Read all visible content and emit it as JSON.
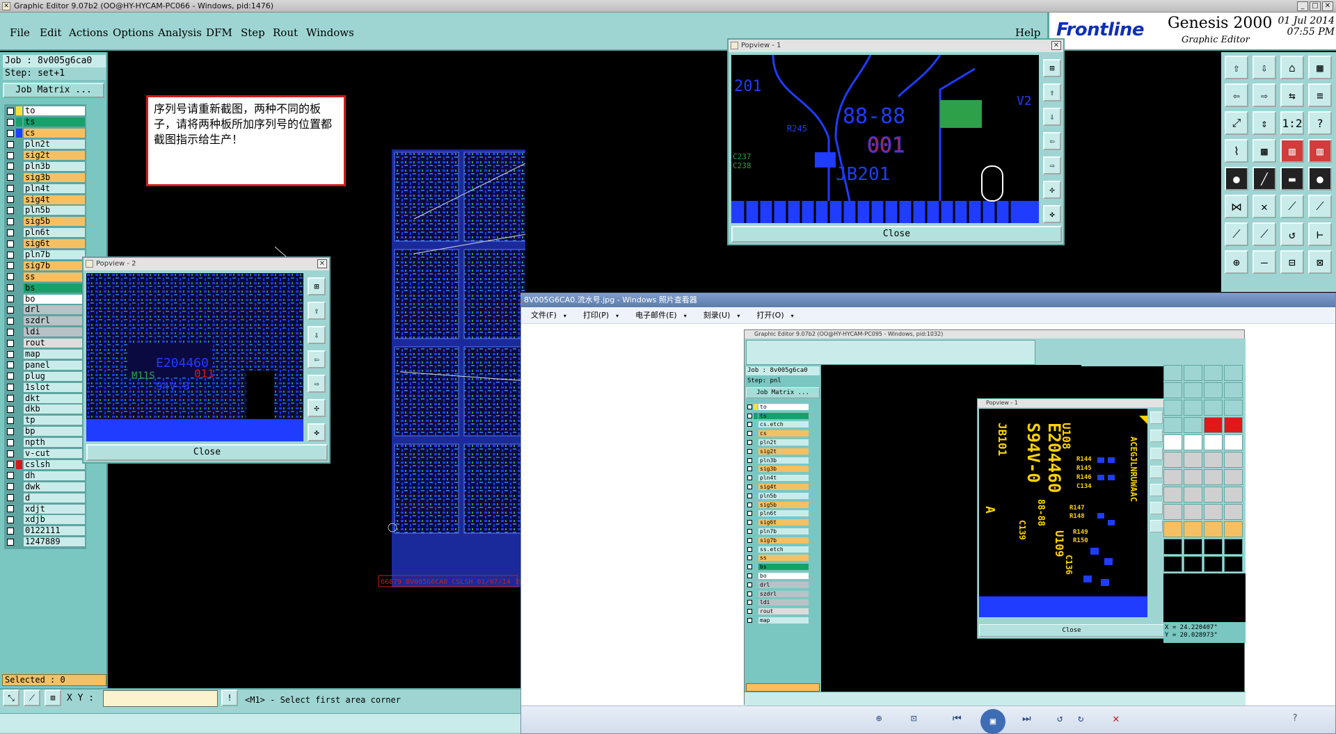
{
  "window": {
    "title": "Graphic Editor 9.07b2 (OO@HY-HYCAM-PC066 - Windows, pid:1476)",
    "icon": "editor-icon"
  },
  "menu": {
    "items": [
      "File",
      "Edit",
      "Actions",
      "Options",
      "Analysis",
      "DFM",
      "Step",
      "Rout",
      "Windows"
    ],
    "help": "Help"
  },
  "brand": {
    "logo": "Frontline",
    "product": "Genesis 2000",
    "subtitle": "Graphic Editor",
    "date": "01 Jul 2014",
    "time": "07:55 PM"
  },
  "job": {
    "name": "Job : 8v005g6ca0",
    "step": "Step: set+1",
    "matrix_button": "Job Matrix ..."
  },
  "layers": [
    {
      "name": "to",
      "color": "#ffffff",
      "swatch": "#f3e23b"
    },
    {
      "name": "ts",
      "color": "#18a06a",
      "swatch": "#18a06a"
    },
    {
      "name": "cs",
      "color": "#f5c063",
      "swatch": "#1e40ff"
    },
    {
      "name": "pln2t",
      "color": "#c9ecea",
      "swatch": ""
    },
    {
      "name": "sig2t",
      "color": "#f5c063",
      "swatch": ""
    },
    {
      "name": "pln3b",
      "color": "#c9ecea",
      "swatch": ""
    },
    {
      "name": "sig3b",
      "color": "#f5c063",
      "swatch": ""
    },
    {
      "name": "pln4t",
      "color": "#c9ecea",
      "swatch": ""
    },
    {
      "name": "sig4t",
      "color": "#f5c063",
      "swatch": ""
    },
    {
      "name": "pln5b",
      "color": "#c9ecea",
      "swatch": ""
    },
    {
      "name": "sig5b",
      "color": "#f5c063",
      "swatch": ""
    },
    {
      "name": "pln6t",
      "color": "#c9ecea",
      "swatch": ""
    },
    {
      "name": "sig6t",
      "color": "#f5c063",
      "swatch": ""
    },
    {
      "name": "pln7b",
      "color": "#c9ecea",
      "swatch": ""
    },
    {
      "name": "sig7b",
      "color": "#f5c063",
      "swatch": ""
    },
    {
      "name": "ss",
      "color": "#f5c063",
      "swatch": ""
    },
    {
      "name": "bs",
      "color": "#18a06a",
      "swatch": ""
    },
    {
      "name": "bo",
      "color": "#ffffff",
      "swatch": ""
    },
    {
      "name": "drl",
      "color": "#b9c2c6",
      "swatch": ""
    },
    {
      "name": "szdrl",
      "color": "#b9c2c6",
      "swatch": ""
    },
    {
      "name": "ldi",
      "color": "#b9c2c6",
      "swatch": ""
    },
    {
      "name": "rout",
      "color": "#dcdcdc",
      "swatch": ""
    },
    {
      "name": "map",
      "color": "#c9ecea",
      "swatch": ""
    },
    {
      "name": "panel",
      "color": "#c9ecea",
      "swatch": ""
    },
    {
      "name": "plug",
      "color": "#c9ecea",
      "swatch": ""
    },
    {
      "name": "1slot",
      "color": "#c9ecea",
      "swatch": ""
    },
    {
      "name": "dkt",
      "color": "#c9ecea",
      "swatch": ""
    },
    {
      "name": "dkb",
      "color": "#c9ecea",
      "swatch": ""
    },
    {
      "name": "tp",
      "color": "#c9ecea",
      "swatch": ""
    },
    {
      "name": "bp",
      "color": "#c9ecea",
      "swatch": ""
    },
    {
      "name": "npth",
      "color": "#c9ecea",
      "swatch": ""
    },
    {
      "name": "v-cut",
      "color": "#c9ecea",
      "swatch": ""
    },
    {
      "name": "cslsh",
      "color": "#c9ecea",
      "swatch": "#d21a1a"
    },
    {
      "name": "dh",
      "color": "#c9ecea",
      "swatch": ""
    },
    {
      "name": "dwk",
      "color": "#c9ecea",
      "swatch": ""
    },
    {
      "name": "d",
      "color": "#c9ecea",
      "swatch": ""
    },
    {
      "name": "xdjt",
      "color": "#c9ecea",
      "swatch": ""
    },
    {
      "name": "xdjb",
      "color": "#c9ecea",
      "swatch": ""
    },
    {
      "name": "0122111",
      "color": "#c9ecea",
      "swatch": ""
    },
    {
      "name": "1247889",
      "color": "#c9ecea",
      "swatch": ""
    }
  ],
  "selected": "Selected : 0",
  "bottom": {
    "xy_label": "X Y :",
    "xy_value": "",
    "status": "<M1> - Select first area corner"
  },
  "note": {
    "text": "序列号请重新截图，两种不同的板子，请将两种板所加序列号的位置都截图指示给生产！"
  },
  "popview1": {
    "title": "Popview - 1",
    "close": "Close",
    "labels": [
      "201",
      "R245",
      "88-88",
      "001",
      "JB201",
      "C237",
      "C238",
      "V2"
    ]
  },
  "popview2": {
    "title": "Popview - 2",
    "close": "Close",
    "labels": [
      "E204460",
      "M11S",
      "011",
      "94V-0"
    ]
  },
  "canvas_stamp": "66879 8V005G6CA0 CSLSH 01/07/14 19:57",
  "viewer": {
    "title": "8V005G6CA0.流水号.jpg - Windows 照片查看器",
    "menu": [
      "文件(F)",
      "打印(P)",
      "电子邮件(E)",
      "刻录(U)",
      "打开(O)"
    ],
    "inner_title": "Graphic Editor 9.07b2 (OO@HY-HYCAM-PC095 - Windows, pid:1032)",
    "inner_job": "Job : 8v005g6ca0",
    "inner_step": "Step: pnl",
    "inner_matrix": "Job Matrix ...",
    "inner_layers": [
      "to",
      "ts",
      "cs.etch",
      "cs",
      "pln2t",
      "sig2t",
      "pln3b",
      "sig3b",
      "pln4t",
      "sig4t",
      "pln5b",
      "sig5b",
      "pln6t",
      "sig6t",
      "pln7b",
      "sig7b",
      "ss.etch",
      "ss",
      "bs",
      "bo",
      "drl",
      "szdrl",
      "ldi",
      "rout",
      "map"
    ],
    "inner_popview_title": "Popview - 1",
    "inner_popview_close": "Close",
    "inner_labels": [
      "U108",
      "E204460",
      "S94V-0",
      "JB101",
      "88-88",
      "U109",
      "C139",
      "C136",
      "R144",
      "R145",
      "R146",
      "C134",
      "R147",
      "R148",
      "R149",
      "R150",
      "ACEGJLNRUWAAC",
      "A"
    ],
    "coords": [
      "X = 24.220407\"",
      "Y = 20.028973\""
    ]
  }
}
